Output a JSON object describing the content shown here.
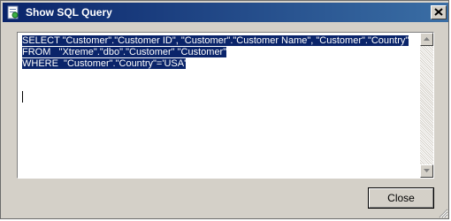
{
  "window": {
    "title": "Show SQL Query",
    "icon": "sql-query-icon"
  },
  "query": {
    "lines": [
      "SELECT \"Customer\".\"Customer ID\", \"Customer\".\"Customer Name\", \"Customer\".\"Country\"",
      "FROM   \"Xtreme\".\"dbo\".\"Customer\" \"Customer\"",
      "WHERE  \"Customer\".\"Country\"='USA'"
    ]
  },
  "buttons": {
    "close_label": "Close"
  },
  "colors": {
    "title_bar_start": "#0a246a",
    "title_bar_end": "#3a6ea5",
    "selection": "#0a246a",
    "dialog_bg": "#d4d0c8"
  }
}
